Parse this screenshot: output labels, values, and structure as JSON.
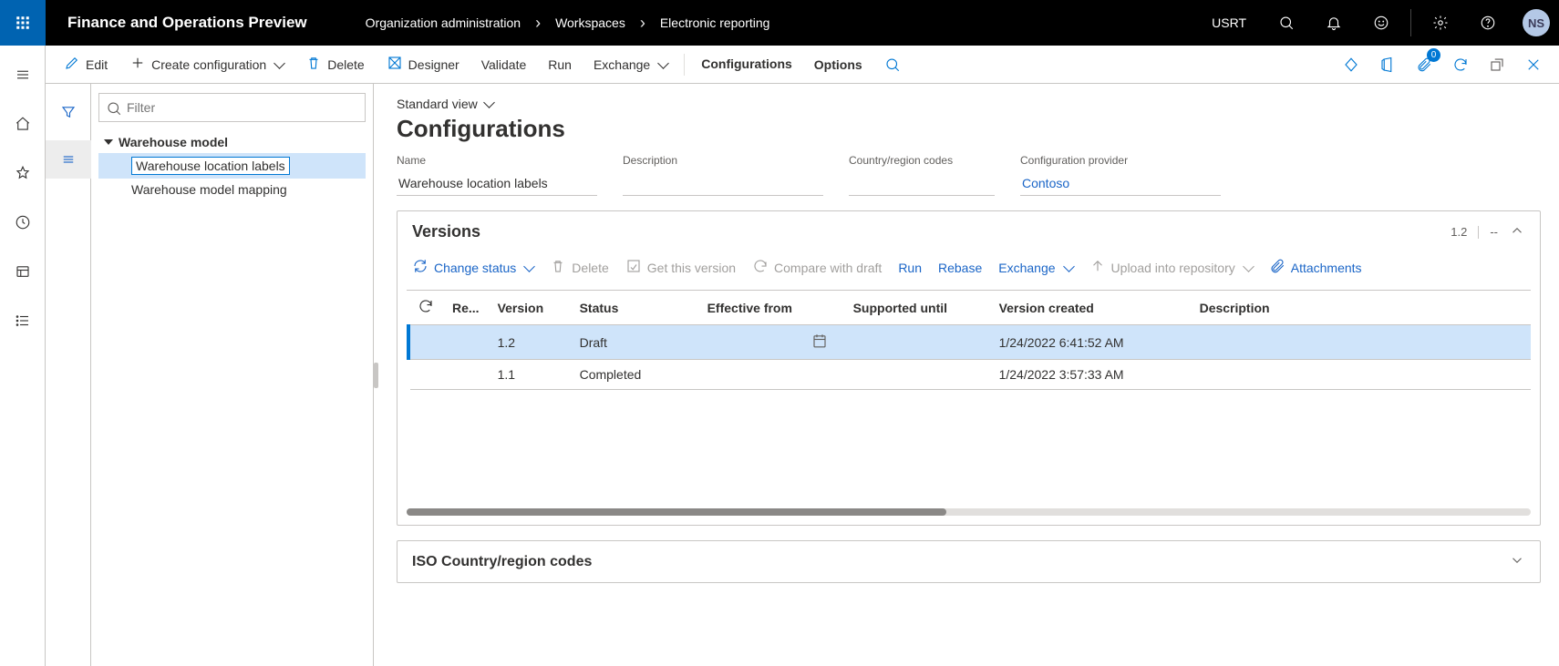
{
  "topbar": {
    "app_title": "Finance and Operations Preview",
    "breadcrumbs": [
      "Organization administration",
      "Workspaces",
      "Electronic reporting"
    ],
    "company": "USRT",
    "avatar": "NS"
  },
  "actionbar": {
    "edit": "Edit",
    "create": "Create configuration",
    "delete": "Delete",
    "designer": "Designer",
    "validate": "Validate",
    "run": "Run",
    "exchange": "Exchange",
    "tab_configurations": "Configurations",
    "tab_options": "Options",
    "attach_count": "0"
  },
  "tree": {
    "filter_placeholder": "Filter",
    "root": "Warehouse model",
    "children": [
      {
        "label": "Warehouse location labels",
        "selected": true
      },
      {
        "label": "Warehouse model mapping",
        "selected": false
      }
    ]
  },
  "page": {
    "view_label": "Standard view",
    "title": "Configurations",
    "fields": {
      "name_label": "Name",
      "name_value": "Warehouse location labels",
      "desc_label": "Description",
      "desc_value": "",
      "country_label": "Country/region codes",
      "country_value": "",
      "provider_label": "Configuration provider",
      "provider_value": "Contoso"
    }
  },
  "versions": {
    "title": "Versions",
    "summary_version": "1.2",
    "summary_dash": "--",
    "toolbar": {
      "change_status": "Change status",
      "delete": "Delete",
      "get_this": "Get this version",
      "compare": "Compare with draft",
      "run": "Run",
      "rebase": "Rebase",
      "exchange": "Exchange",
      "upload": "Upload into repository",
      "attachments": "Attachments"
    },
    "columns": {
      "re": "Re...",
      "version": "Version",
      "status": "Status",
      "effective": "Effective from",
      "supported": "Supported until",
      "created": "Version created",
      "description": "Description"
    },
    "rows": [
      {
        "version": "1.2",
        "status": "Draft",
        "effective_icon": true,
        "supported": "",
        "created": "1/24/2022 6:41:52 AM",
        "description": "",
        "selected": true
      },
      {
        "version": "1.1",
        "status": "Completed",
        "effective_icon": false,
        "supported": "",
        "created": "1/24/2022 3:57:33 AM",
        "description": "",
        "selected": false
      }
    ]
  },
  "iso": {
    "title": "ISO Country/region codes"
  }
}
